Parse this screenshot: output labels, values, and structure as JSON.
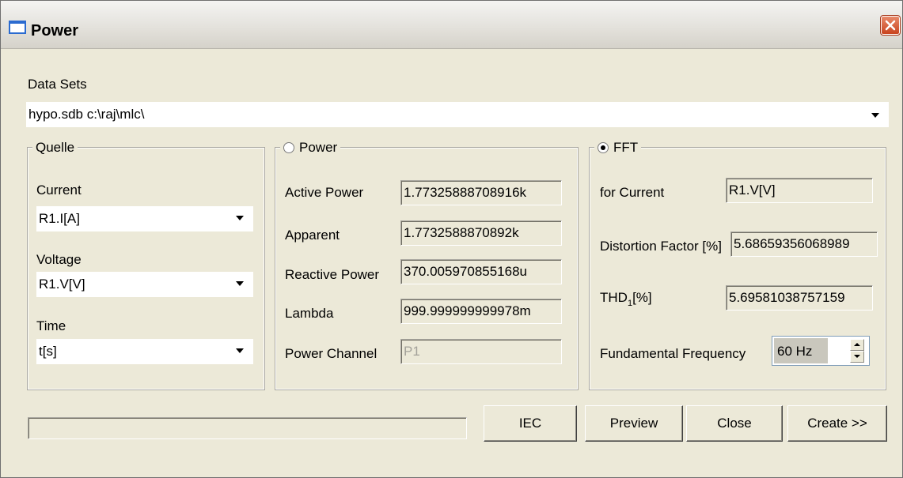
{
  "window": {
    "title": "Power"
  },
  "datasets": {
    "label": "Data Sets",
    "value": "hypo.sdb c:\\raj\\mlc\\"
  },
  "quelle": {
    "legend": "Quelle",
    "current_label": "Current",
    "current_value": "R1.I[A]",
    "voltage_label": "Voltage",
    "voltage_value": "R1.V[V]",
    "time_label": "Time",
    "time_value": "t[s]"
  },
  "power": {
    "legend": "Power",
    "selected": false,
    "rows": [
      {
        "label": "Active Power",
        "value": "1.77325888708916k"
      },
      {
        "label": "Apparent",
        "value": "1.7732588870892k"
      },
      {
        "label": "Reactive Power",
        "value": "370.005970855168u"
      },
      {
        "label": "Lambda",
        "value": "999.999999999978m"
      },
      {
        "label": "Power Channel",
        "value": "P1"
      }
    ]
  },
  "fft": {
    "legend": "FFT",
    "selected": true,
    "for_current_label": "for Current",
    "for_current_value": "R1.V[V]",
    "distortion_label": "Distortion Factor [%]",
    "distortion_value": "5.68659356068989",
    "thd_label_main": "THD",
    "thd_label_sub": "1",
    "thd_label_end": "[%]",
    "thd_value": "5.69581038757159",
    "fundamental_label": "Fundamental Frequency",
    "fundamental_value": "60 Hz"
  },
  "buttons": {
    "iec": "IEC",
    "preview": "Preview",
    "close": "Close",
    "create": "Create >>"
  },
  "progress": {
    "percent": 0
  }
}
